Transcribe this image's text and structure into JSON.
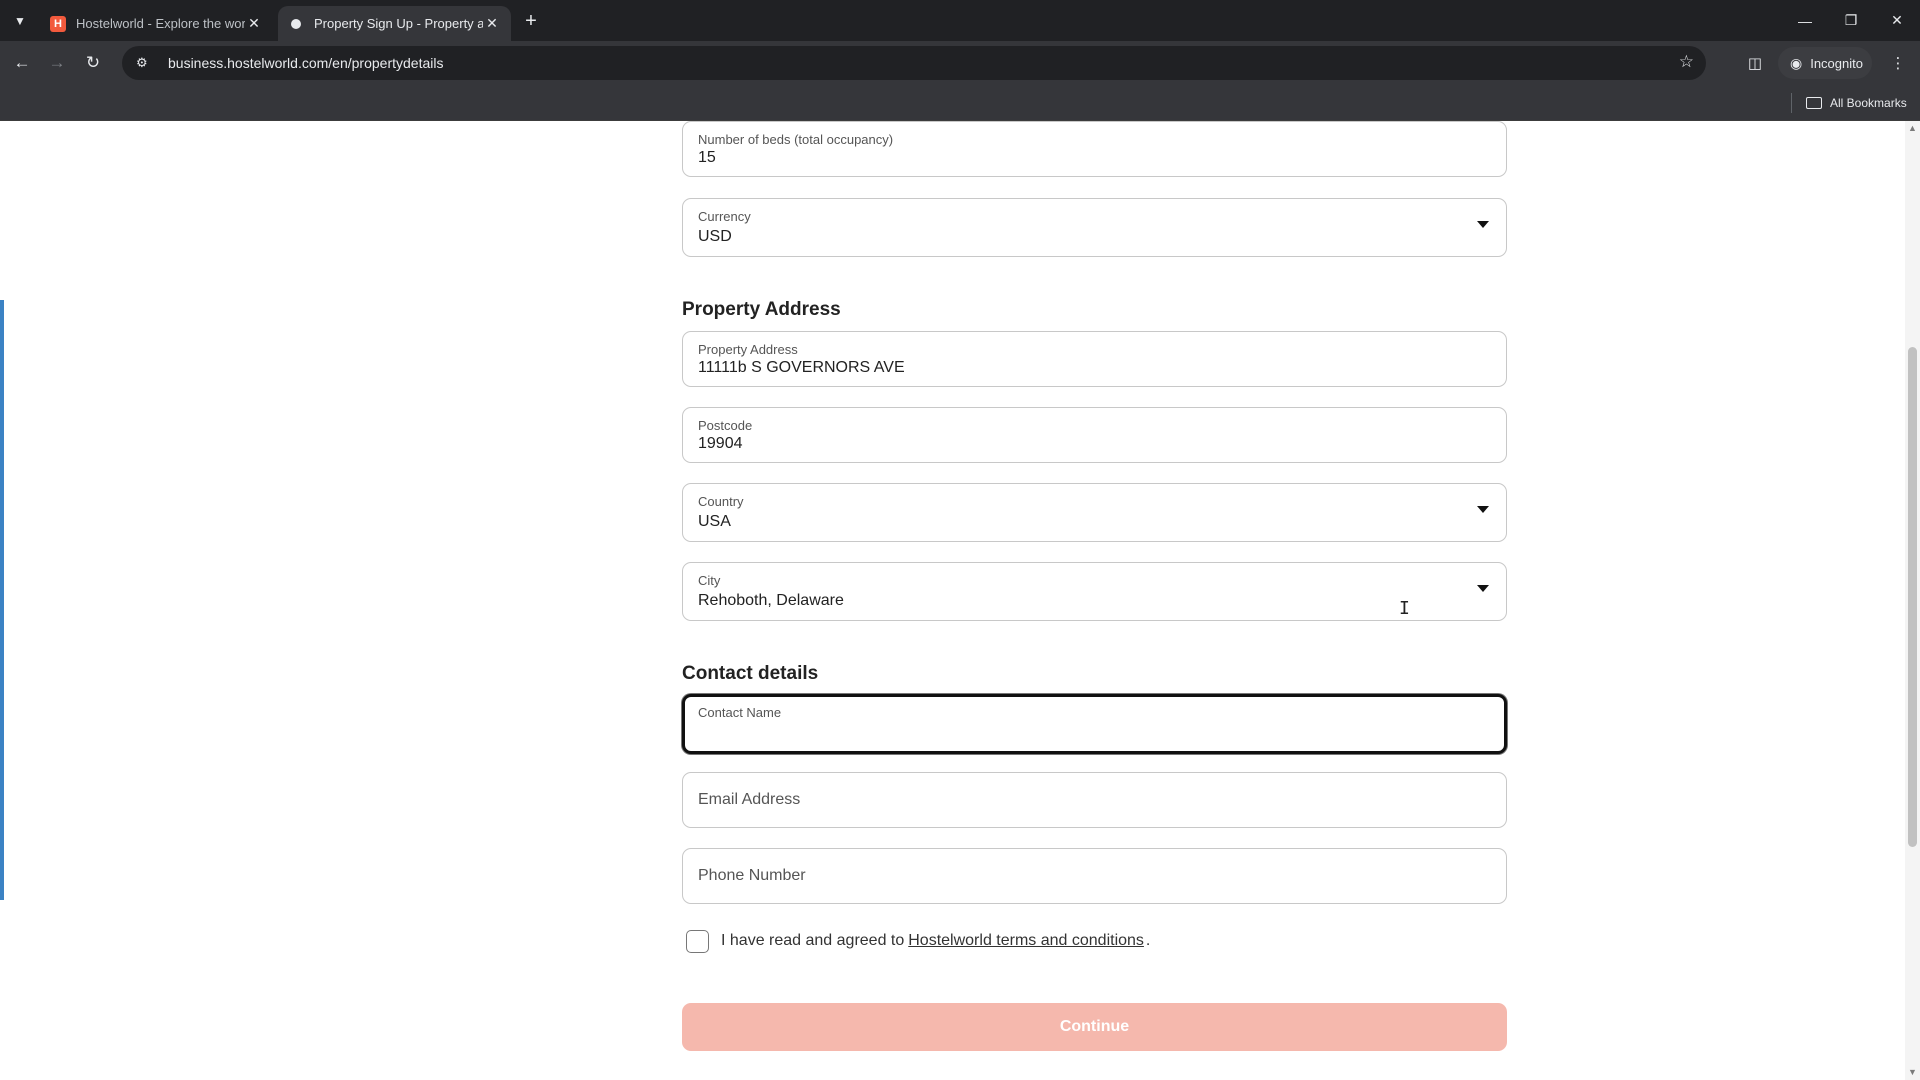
{
  "browser": {
    "tabs": [
      {
        "title": "Hostelworld - Explore the world",
        "favicon": "hostelworld-logo",
        "active": false
      },
      {
        "title": "Property Sign Up - Property and",
        "favicon": "loading-dot",
        "active": true
      }
    ],
    "url": "business.hostelworld.com/en/propertydetails",
    "incognito_label": "Incognito",
    "all_bookmarks_label": "All Bookmarks"
  },
  "form": {
    "beds": {
      "label": "Number of beds (total occupancy)",
      "value": "15"
    },
    "currency": {
      "label": "Currency",
      "value": "USD"
    },
    "address_section_title": "Property Address",
    "address": {
      "label": "Property Address",
      "value": "11111b S GOVERNORS AVE"
    },
    "postcode": {
      "label": "Postcode",
      "value": "19904"
    },
    "country": {
      "label": "Country",
      "value": "USA"
    },
    "city": {
      "label": "City",
      "value": "Rehoboth, Delaware"
    },
    "contact_section_title": "Contact details",
    "contact_name": {
      "label": "Contact Name",
      "value": ""
    },
    "email": {
      "placeholder": "Email Address"
    },
    "phone": {
      "placeholder": "Phone Number"
    },
    "terms": {
      "prefix": "I have read and agreed to",
      "link": "Hostelworld terms and conditions",
      "suffix": ".",
      "checked": false
    },
    "continue_label": "Continue"
  },
  "colors": {
    "continue_disabled": "#f5b8ad",
    "focus_border": "#111111",
    "accent_bar": "#3b82c4"
  }
}
